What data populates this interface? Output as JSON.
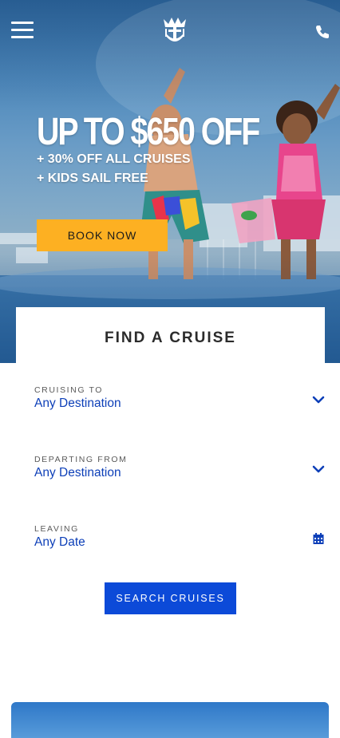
{
  "header": {
    "menu_icon": "hamburger-menu-icon",
    "logo_icon": "royal-crown-anchor-logo",
    "phone_icon": "phone-icon"
  },
  "hero": {
    "title": "UP TO $650 OFF",
    "line1": "+ 30% OFF ALL CRUISES",
    "line2": "+ KIDS SAIL FREE",
    "cta_label": "BOOK NOW",
    "cta_color": "#fdb022"
  },
  "finder": {
    "title": "FIND A CRUISE",
    "fields": [
      {
        "label": "CRUISING TO",
        "value": "Any Destination",
        "icon": "chevron-down-icon"
      },
      {
        "label": "DEPARTING FROM",
        "value": "Any Destination",
        "icon": "chevron-down-icon"
      },
      {
        "label": "LEAVING",
        "value": "Any Date",
        "icon": "calendar-icon"
      }
    ],
    "search_label": "SEARCH CRUISES",
    "accent_color": "#0c4ad8",
    "value_color": "#0d3fb8"
  }
}
